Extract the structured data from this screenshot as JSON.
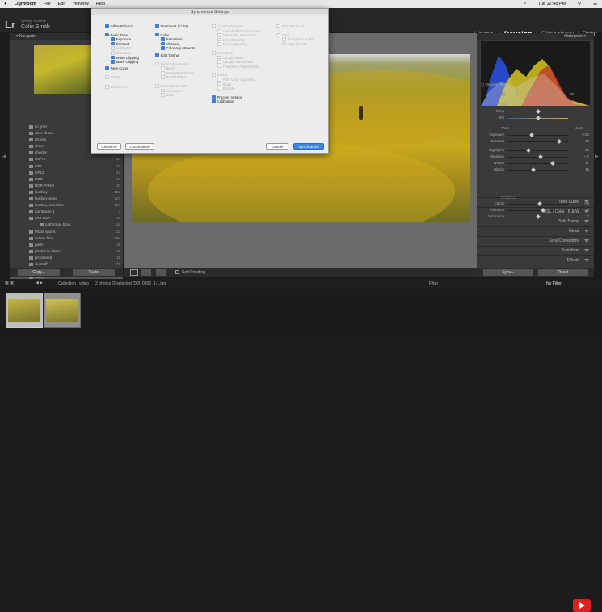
{
  "menubar": {
    "app": "Lightroom",
    "items": [
      "File",
      "Edit",
      "Window",
      "Help"
    ],
    "clock": "Tue 12:48 PM"
  },
  "identity": {
    "logo": "Lr",
    "subtitle": "Syncing 4 photos",
    "name": "Colin Smith"
  },
  "modules": [
    "Library",
    "Develop",
    "Slideshow",
    "Print"
  ],
  "active_module": "Develop",
  "left_panel": {
    "navigator_label": "Navigator",
    "folders": [
      {
        "name": "cc grief",
        "count": "21"
      },
      {
        "name": "dave drone",
        "count": "29"
      },
      {
        "name": "drones",
        "count": "18"
      },
      {
        "name": "drone",
        "count": "31"
      },
      {
        "name": "chester",
        "count": "22"
      },
      {
        "name": "GoPro",
        "count": "40"
      },
      {
        "name": "GP1",
        "count": "23"
      },
      {
        "name": "GP11",
        "count": "27"
      },
      {
        "name": "HDR",
        "count": "16"
      },
      {
        "name": "HDR PANO",
        "count": "15"
      },
      {
        "name": "landsky",
        "count": "152"
      },
      {
        "name": "landsky-video",
        "count": "127"
      },
      {
        "name": "landsky-videostrs",
        "count": "166"
      },
      {
        "name": "Lightroom 4",
        "count": "3"
      },
      {
        "name": "LR5 DSA",
        "count": "11"
      },
      {
        "name": "Lightroom book",
        "count": "18"
      },
      {
        "name": "Motor sports",
        "count": "13"
      },
      {
        "name": "nelson hike",
        "count": "458"
      },
      {
        "name": "parm",
        "count": "11"
      },
      {
        "name": "photos to share",
        "count": "41"
      },
      {
        "name": "processed",
        "count": "11"
      },
      {
        "name": "ski stuff",
        "count": "75"
      },
      {
        "name": "tie-part",
        "count": "181"
      },
      {
        "name": "video",
        "count": "2"
      }
    ],
    "copy_label": "Copy...",
    "paste_label": "Paste"
  },
  "center": {
    "soft_proofing_label": "Soft Proofing"
  },
  "right_panel": {
    "histogram_label": "Histogram",
    "original_photo_label": "Original Photo",
    "wb_label": "WB :",
    "wb_value": "As Shot",
    "temp_label": "Temp",
    "tint_label": "Tint",
    "tone_label": "Tone",
    "auto_label": "Auto",
    "tone_sliders": [
      {
        "label": "Exposure",
        "value": "-2.00",
        "pos": 0.4
      },
      {
        "label": "Contrast",
        "value": "+ 70",
        "pos": 0.85
      }
    ],
    "tone2_sliders": [
      {
        "label": "Highlights",
        "value": "- 35",
        "pos": 0.35
      },
      {
        "label": "Shadows",
        "value": "+ 7",
        "pos": 0.54
      },
      {
        "label": "Whites",
        "value": "+ 47",
        "pos": 0.75
      },
      {
        "label": "Blacks",
        "value": "- 16",
        "pos": 0.42
      }
    ],
    "presence_label": "Presence",
    "presence_sliders": [
      {
        "label": "Clarity",
        "value": "+ 6",
        "pos": 0.53
      },
      {
        "label": "Vibrance",
        "value": "+ 16",
        "pos": 0.58
      },
      {
        "label": "Saturation",
        "value": "0",
        "pos": 0.5
      }
    ],
    "panels": [
      "Tone Curve",
      "HSL / Color / B & W",
      "Split Toning",
      "Detail",
      "Lens Corrections",
      "Transform",
      "Effects"
    ],
    "sync_label": "Sync...",
    "reset_label": "Reset"
  },
  "filmstrip": {
    "source": "Collection : video",
    "selection": "2 photos /2 selected /DJI_0068_1-1.jpg",
    "filter_label": "Filter :",
    "filter_value": "No Filter"
  },
  "dialog": {
    "title": "Synchronize Settings",
    "col1": [
      {
        "label": "White Balance",
        "state": "on",
        "indent": 0
      },
      {
        "label": "Basic Tone",
        "state": "on",
        "indent": 0
      },
      {
        "label": "Exposure",
        "state": "on",
        "indent": 1
      },
      {
        "label": "Contrast",
        "state": "on",
        "indent": 1
      },
      {
        "label": "Highlights",
        "state": "dis",
        "indent": 1
      },
      {
        "label": "Shadows",
        "state": "dis",
        "indent": 1
      },
      {
        "label": "White Clipping",
        "state": "on",
        "indent": 1
      },
      {
        "label": "Black Clipping",
        "state": "on",
        "indent": 1
      },
      {
        "label": "Tone Curve",
        "state": "on",
        "indent": 0
      },
      {
        "label": "Clarity",
        "state": "dis",
        "indent": 0
      },
      {
        "label": "Sharpening",
        "state": "dis",
        "indent": 0
      }
    ],
    "col2": [
      {
        "label": "Treatment (Color)",
        "state": "on",
        "indent": 0
      },
      {
        "label": "Color",
        "state": "on",
        "indent": 0
      },
      {
        "label": "Saturation",
        "state": "on",
        "indent": 1
      },
      {
        "label": "Vibrance",
        "state": "on",
        "indent": 1
      },
      {
        "label": "Color Adjustments",
        "state": "on",
        "indent": 1
      },
      {
        "label": "Split Toning",
        "state": "on",
        "indent": 0
      },
      {
        "label": "Local Adjustments",
        "state": "dis",
        "indent": 0
      },
      {
        "label": "Brush",
        "state": "dis",
        "indent": 1
      },
      {
        "label": "Graduated Filters",
        "state": "dis",
        "indent": 1
      },
      {
        "label": "Radial Filters",
        "state": "dis",
        "indent": 1
      },
      {
        "label": "Noise Reduction",
        "state": "dis",
        "indent": 0
      },
      {
        "label": "Luminance",
        "state": "dis",
        "indent": 1
      },
      {
        "label": "Color",
        "state": "dis",
        "indent": 1
      }
    ],
    "col3": [
      {
        "label": "Lens Corrections",
        "state": "dis",
        "indent": 0
      },
      {
        "label": "Lens Profile Corrections",
        "state": "dis",
        "indent": 1
      },
      {
        "label": "Chromatic Aberration",
        "state": "dis",
        "indent": 1
      },
      {
        "label": "Lens Distortion",
        "state": "dis",
        "indent": 1
      },
      {
        "label": "Lens Vignetting",
        "state": "dis",
        "indent": 1
      },
      {
        "label": "Transform",
        "state": "dis",
        "indent": 0
      },
      {
        "label": "Upright Mode",
        "state": "dis",
        "indent": 1
      },
      {
        "label": "Upright Transforms",
        "state": "dis",
        "indent": 1
      },
      {
        "label": "Transform Adjustments",
        "state": "dis",
        "indent": 1
      },
      {
        "label": "Effects",
        "state": "dis",
        "indent": 0
      },
      {
        "label": "Post-Crop Vignetting",
        "state": "dis",
        "indent": 1
      },
      {
        "label": "Grain",
        "state": "dis",
        "indent": 1
      },
      {
        "label": "Dehaze",
        "state": "dis",
        "indent": 1
      },
      {
        "label": "Process Version",
        "state": "on",
        "indent": 0
      },
      {
        "label": "Calibration",
        "state": "on",
        "indent": 0
      }
    ],
    "col4": [
      {
        "label": "Spot Removal",
        "state": "dis",
        "indent": 0
      },
      {
        "label": "Crop",
        "state": "dis",
        "indent": 0
      },
      {
        "label": "Straighten Angle",
        "state": "dis",
        "indent": 1
      },
      {
        "label": "Aspect Ratio",
        "state": "dis",
        "indent": 1
      }
    ],
    "check_all_label": "Check All",
    "check_none_label": "Check None",
    "cancel_label": "Cancel",
    "sync_label": "Synchronize"
  }
}
